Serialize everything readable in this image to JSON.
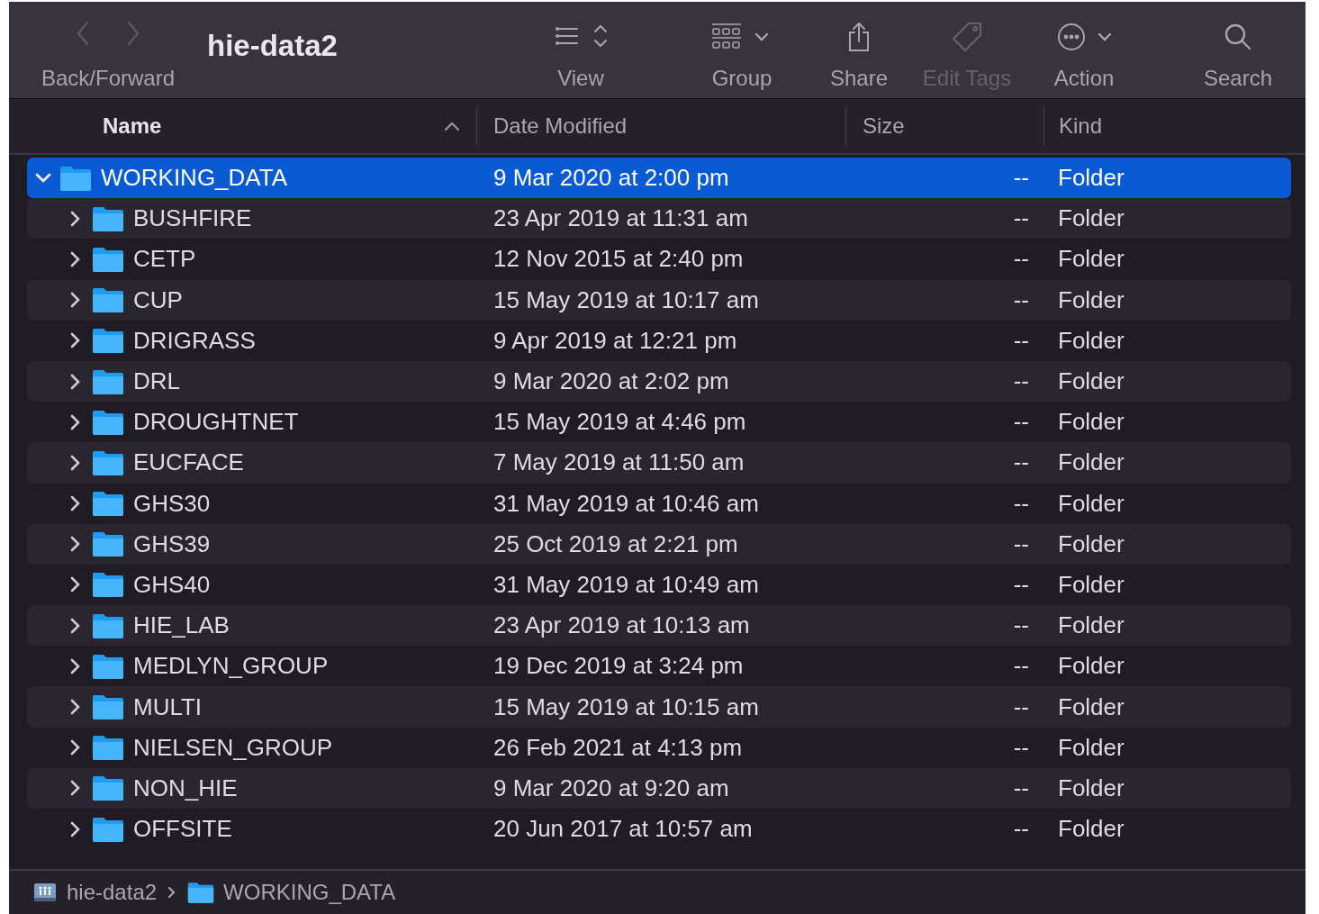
{
  "window": {
    "title": "hie-data2"
  },
  "toolbar": {
    "nav_label": "Back/Forward",
    "items": [
      {
        "kind": "view",
        "label": "View",
        "disabled": false
      },
      {
        "kind": "group",
        "label": "Group",
        "disabled": false
      },
      {
        "kind": "share",
        "label": "Share",
        "disabled": false
      },
      {
        "kind": "tags",
        "label": "Edit Tags",
        "disabled": true
      },
      {
        "kind": "action",
        "label": "Action",
        "disabled": false
      },
      {
        "kind": "search",
        "label": "Search",
        "disabled": false
      }
    ]
  },
  "table": {
    "columns": [
      {
        "label": "Name",
        "sorted": true
      },
      {
        "label": "Date Modified",
        "sorted": false
      },
      {
        "label": "Size",
        "sorted": false
      },
      {
        "label": "Kind",
        "sorted": false
      }
    ],
    "rows": [
      {
        "name": "WORKING_DATA",
        "date": "9 Mar 2020 at 2:00 pm",
        "size": "--",
        "kind": "Folder",
        "expanded": true,
        "selected": true,
        "children": [
          {
            "name": "BUSHFIRE",
            "date": "23 Apr 2019 at 11:31 am",
            "size": "--",
            "kind": "Folder",
            "expanded": false,
            "selected": false
          },
          {
            "name": "CETP",
            "date": "12 Nov 2015 at 2:40 pm",
            "size": "--",
            "kind": "Folder",
            "expanded": false,
            "selected": false
          },
          {
            "name": "CUP",
            "date": "15 May 2019 at 10:17 am",
            "size": "--",
            "kind": "Folder",
            "expanded": false,
            "selected": false
          },
          {
            "name": "DRIGRASS",
            "date": "9 Apr 2019 at 12:21 pm",
            "size": "--",
            "kind": "Folder",
            "expanded": false,
            "selected": false
          },
          {
            "name": "DRL",
            "date": "9 Mar 2020 at 2:02 pm",
            "size": "--",
            "kind": "Folder",
            "expanded": false,
            "selected": false
          },
          {
            "name": "DROUGHTNET",
            "date": "15 May 2019 at 4:46 pm",
            "size": "--",
            "kind": "Folder",
            "expanded": false,
            "selected": false
          },
          {
            "name": "EUCFACE",
            "date": "7 May 2019 at 11:50 am",
            "size": "--",
            "kind": "Folder",
            "expanded": false,
            "selected": false
          },
          {
            "name": "GHS30",
            "date": "31 May 2019 at 10:46 am",
            "size": "--",
            "kind": "Folder",
            "expanded": false,
            "selected": false
          },
          {
            "name": "GHS39",
            "date": "25 Oct 2019 at 2:21 pm",
            "size": "--",
            "kind": "Folder",
            "expanded": false,
            "selected": false
          },
          {
            "name": "GHS40",
            "date": "31 May 2019 at 10:49 am",
            "size": "--",
            "kind": "Folder",
            "expanded": false,
            "selected": false
          },
          {
            "name": "HIE_LAB",
            "date": "23 Apr 2019 at 10:13 am",
            "size": "--",
            "kind": "Folder",
            "expanded": false,
            "selected": false
          },
          {
            "name": "MEDLYN_GROUP",
            "date": "19 Dec 2019 at 3:24 pm",
            "size": "--",
            "kind": "Folder",
            "expanded": false,
            "selected": false
          },
          {
            "name": "MULTI",
            "date": "15 May 2019 at 10:15 am",
            "size": "--",
            "kind": "Folder",
            "expanded": false,
            "selected": false
          },
          {
            "name": "NIELSEN_GROUP",
            "date": "26 Feb 2021 at 4:13 pm",
            "size": "--",
            "kind": "Folder",
            "expanded": false,
            "selected": false
          },
          {
            "name": "NON_HIE",
            "date": "9 Mar 2020 at 9:20 am",
            "size": "--",
            "kind": "Folder",
            "expanded": false,
            "selected": false
          },
          {
            "name": "OFFSITE",
            "date": "20 Jun 2017 at 10:57 am",
            "size": "--",
            "kind": "Folder",
            "expanded": false,
            "selected": false
          }
        ]
      }
    ]
  },
  "path_bar": [
    {
      "kind": "drive",
      "label": "hie-data2"
    },
    {
      "kind": "folder",
      "label": "WORKING_DATA"
    }
  ]
}
